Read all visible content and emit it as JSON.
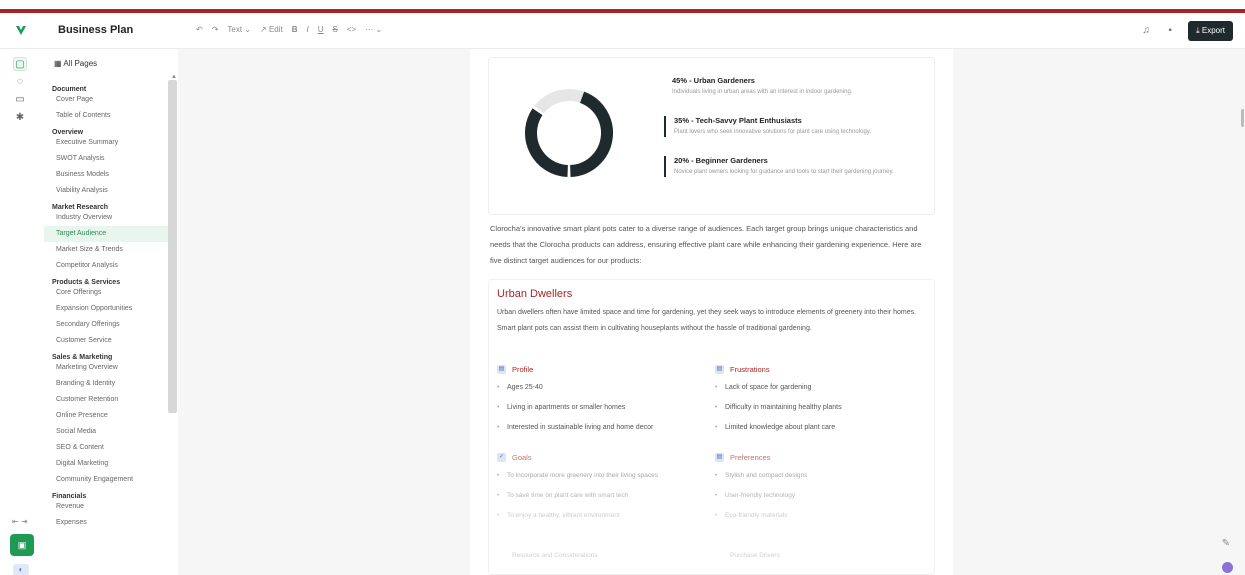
{
  "app": {
    "doc_title": "Business Plan",
    "export_label": "Export",
    "colors": {
      "accent": "#1e9a55",
      "brand_red": "#a92524",
      "dark": "#1f2a2e",
      "link_blue": "#4a6fb0"
    }
  },
  "toolbar": {
    "undo": "↶",
    "redo": "↷",
    "text_style": "Text ⌄",
    "edit": "↗ Edit",
    "bold": "B",
    "italic": "I",
    "underline": "U",
    "strike": "S",
    "code": "<>",
    "more": "⋯ ⌄"
  },
  "header_icons": [
    "bell-icon",
    "grid-icon"
  ],
  "rail": {
    "icons": [
      "document-icon",
      "chat-icon",
      "list-icon",
      "settings-icon"
    ],
    "collapse_label": "⇤ ⇥",
    "green_action": "▣",
    "blue_action": "◐"
  },
  "sidebar": {
    "all_pages_label": "All Pages",
    "groups": [
      {
        "title": "Document",
        "items": [
          "Cover Page",
          "Table of Contents"
        ]
      },
      {
        "title": "Overview",
        "items": [
          "Executive Summary",
          "SWOT Analysis",
          "Business Models",
          "Viability Analysis"
        ]
      },
      {
        "title": "Market Research",
        "items": [
          "Industry Overview",
          "Target Audience",
          "Market Size & Trends",
          "Competitor Analysis"
        ]
      },
      {
        "title": "Products & Services",
        "items": [
          "Core Offerings",
          "Expansion Opportunities",
          "Secondary Offerings",
          "Customer Service"
        ]
      },
      {
        "title": "Sales & Marketing",
        "items": [
          "Marketing Overview",
          "Branding & Identity",
          "Customer Retention",
          "Online Presence",
          "Social Media",
          "SEO & Content",
          "Digital Marketing",
          "Community Engagement"
        ]
      },
      {
        "title": "Financials",
        "items": [
          "Revenue",
          "Expenses"
        ]
      }
    ],
    "active_item": "Target Audience"
  },
  "chart": {
    "segments": [
      {
        "title": "45% - Urban Gardeners",
        "desc": "Individuals living in urban areas with an interest in indoor gardening."
      },
      {
        "title": "35% - Tech-Savvy Plant Enthusiasts",
        "desc": "Plant lovers who seek innovative solutions for plant care using technology."
      },
      {
        "title": "20% - Beginner Gardeners",
        "desc": "Novice plant owners looking for guidance and tools to start their gardening journey."
      }
    ]
  },
  "chart_data": {
    "type": "pie",
    "categories": [
      "Urban Gardeners",
      "Tech-Savvy Plant Enthusiasts",
      "Beginner Gardeners"
    ],
    "values": [
      45,
      35,
      20
    ],
    "colors": [
      "#1f2a2e",
      "#1f2a2e",
      "#e6e6e6"
    ]
  },
  "intro": "Clorocha's innovative smart plant pots cater to a diverse range of audiences. Each target group brings unique characteristics and needs that the Clorocha products can address, ensuring effective plant care while enhancing their gardening experience. Here are five distinct target audiences for our products:",
  "section": {
    "title": "Urban Dwellers",
    "desc": "Urban dwellers often have limited space and time for gardening, yet they seek ways to introduce elements of greenery into their homes. Smart plant pots can assist them in cultivating houseplants without the hassle of traditional gardening.",
    "profile": {
      "title": "Profile",
      "icon": "profile-icon",
      "items": [
        "Ages 25-40",
        "Living in apartments or smaller homes",
        "Interested in sustainable living and home decor"
      ]
    },
    "frustrations": {
      "title": "Frustrations",
      "icon": "frustration-icon",
      "items": [
        "Lack of space for gardening",
        "Difficulty in maintaining healthy plants",
        "Limited knowledge about plant care"
      ]
    },
    "goals": {
      "title": "Goals",
      "icon": "goal-icon",
      "items": [
        "To incorporate more greenery into their living spaces",
        "To save time on plant care with smart tech",
        "To enjoy a healthy, vibrant environment"
      ]
    },
    "preferences": {
      "title": "Preferences",
      "icon": "preference-icon",
      "items": [
        "Stylish and compact designs",
        "User-friendly technology",
        "Eco-friendly materials"
      ]
    },
    "ghost_left": "Resource and Considerations",
    "ghost_right": "Purchase Drivers"
  },
  "floating": {
    "help_icon": "✎"
  }
}
